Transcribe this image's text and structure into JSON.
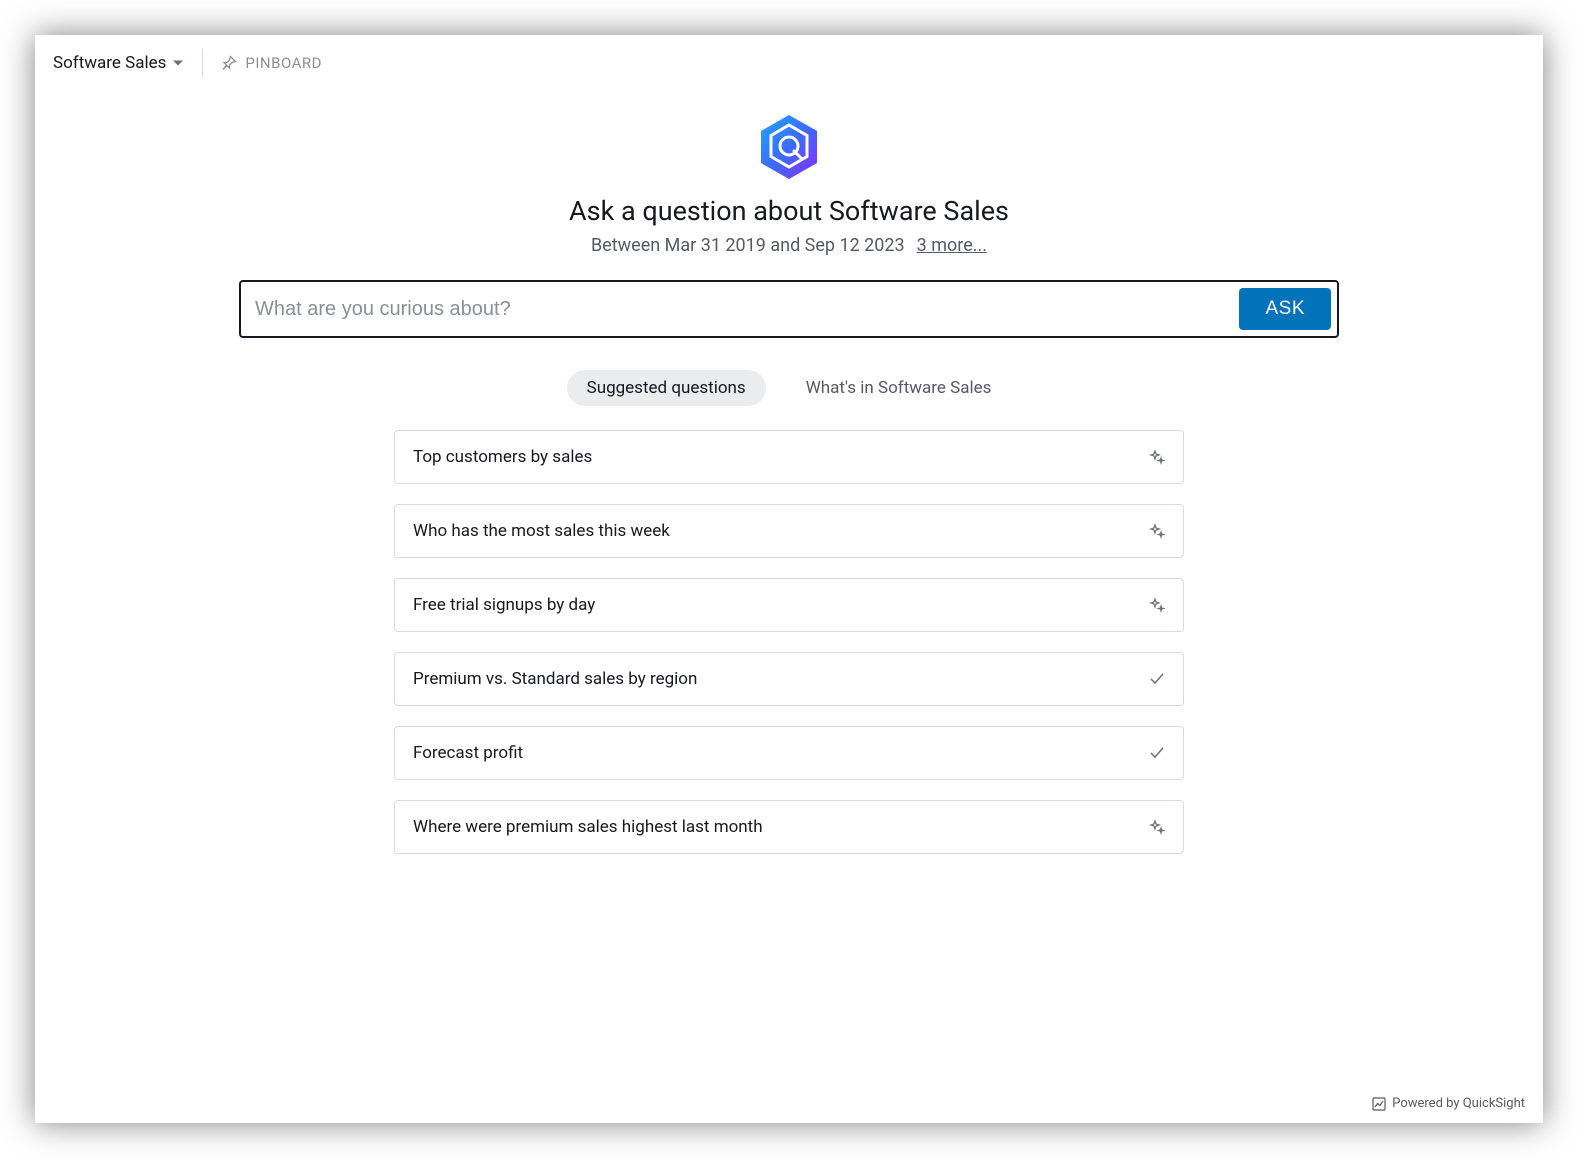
{
  "header": {
    "topic_name": "Software Sales",
    "pinboard_label": "PINBOARD"
  },
  "hero": {
    "title": "Ask a question about Software Sales",
    "date_range": "Between Mar 31 2019 and Sep 12 2023",
    "more_link": "3 more..."
  },
  "search": {
    "placeholder": "What are you curious about?",
    "ask_label": "ASK"
  },
  "tabs": {
    "suggested": "Suggested questions",
    "whats_in": "What's in Software Sales"
  },
  "suggestions": [
    {
      "text": "Top customers by sales",
      "icon": "sparkle"
    },
    {
      "text": "Who has the most sales this week",
      "icon": "sparkle"
    },
    {
      "text": "Free trial signups by day",
      "icon": "sparkle"
    },
    {
      "text": "Premium vs. Standard sales by region",
      "icon": "check"
    },
    {
      "text": "Forecast profit",
      "icon": "check"
    },
    {
      "text": "Where were premium sales highest last month",
      "icon": "sparkle"
    }
  ],
  "footer": {
    "powered_by": "Powered by QuickSight"
  }
}
